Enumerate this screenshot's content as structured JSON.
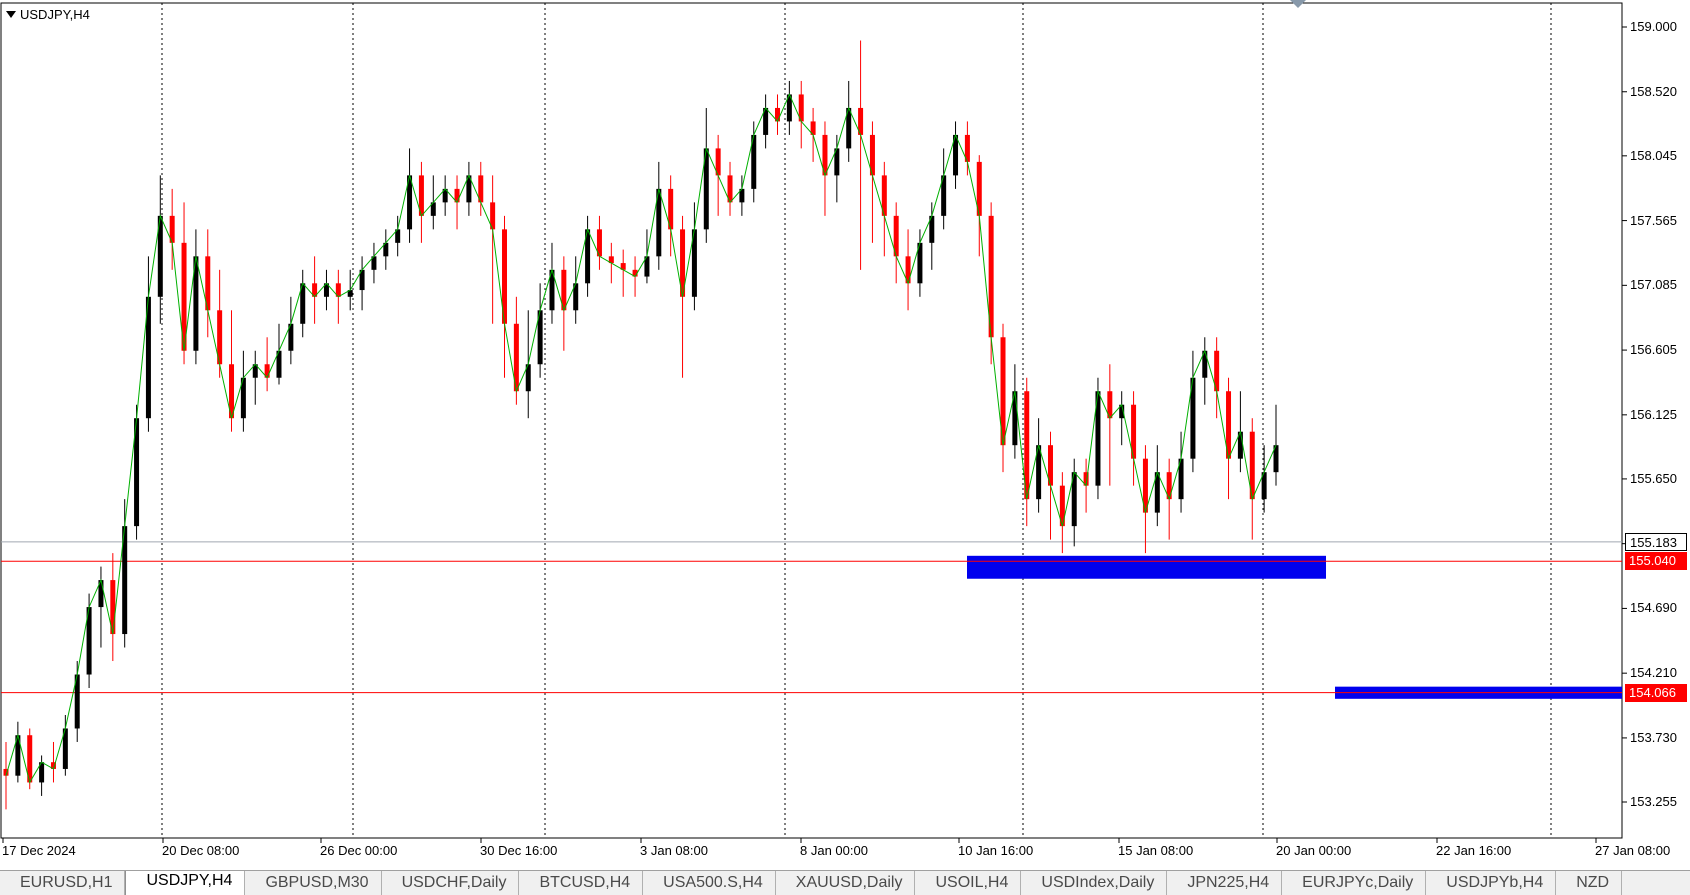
{
  "window": {
    "symbol_label": "USDJPY,H4"
  },
  "chart_data": {
    "type": "candlestick",
    "symbol": "USDJPY",
    "timeframe": "H4",
    "ylim": [
      152.95,
      159.2
    ],
    "y_ticks": [
      "159.000",
      "158.520",
      "158.045",
      "157.565",
      "157.085",
      "156.605",
      "156.125",
      "155.650",
      "155.170",
      "154.690",
      "154.210",
      "153.730",
      "153.255"
    ],
    "x_ticks": [
      "17 Dec 2024",
      "20 Dec 08:00",
      "26 Dec 00:00",
      "30 Dec 16:00",
      "3 Jan 08:00",
      "8 Jan 00:00",
      "10 Jan 16:00",
      "15 Jan 08:00",
      "20 Jan 00:00",
      "22 Jan 16:00",
      "27 Jan 08:00"
    ],
    "current_price": "155.183",
    "horizontal_lines": [
      {
        "price": 155.04,
        "label": "155.040",
        "color": "#ff0000"
      },
      {
        "price": 154.066,
        "label": "154.066",
        "color": "#ff0000"
      }
    ],
    "zones": [
      {
        "price_top": 155.08,
        "price_bottom": 154.91,
        "color": "#0000ee"
      },
      {
        "price_top": 154.11,
        "price_bottom": 154.02,
        "color": "#0000ee"
      }
    ],
    "overlay_line": {
      "name": "",
      "color": "#00b000"
    },
    "candles": [
      [
        153.5,
        153.45,
        153.7,
        153.2
      ],
      [
        153.45,
        153.75,
        153.85,
        153.4
      ],
      [
        153.75,
        153.4,
        153.8,
        153.35
      ],
      [
        153.4,
        153.55,
        153.6,
        153.3
      ],
      [
        153.55,
        153.5,
        153.7,
        153.4
      ],
      [
        153.5,
        153.8,
        153.9,
        153.45
      ],
      [
        153.8,
        154.2,
        154.3,
        153.7
      ],
      [
        154.2,
        154.7,
        154.8,
        154.1
      ],
      [
        154.7,
        154.9,
        155.0,
        154.4
      ],
      [
        154.9,
        154.5,
        155.1,
        154.3
      ],
      [
        154.5,
        155.3,
        155.5,
        154.4
      ],
      [
        155.3,
        156.1,
        156.2,
        155.2
      ],
      [
        156.1,
        157.0,
        157.3,
        156.0
      ],
      [
        157.0,
        157.6,
        157.9,
        156.8
      ],
      [
        157.6,
        157.4,
        157.8,
        157.2
      ],
      [
        157.4,
        156.6,
        157.7,
        156.5
      ],
      [
        156.6,
        157.3,
        157.5,
        156.5
      ],
      [
        157.3,
        156.9,
        157.5,
        156.7
      ],
      [
        156.9,
        156.5,
        157.2,
        156.4
      ],
      [
        156.5,
        156.1,
        156.9,
        156.0
      ],
      [
        156.1,
        156.4,
        156.6,
        156.0
      ],
      [
        156.4,
        156.5,
        156.6,
        156.2
      ],
      [
        156.5,
        156.4,
        156.7,
        156.3
      ],
      [
        156.4,
        156.6,
        156.8,
        156.35
      ],
      [
        156.6,
        156.8,
        157.0,
        156.5
      ],
      [
        156.8,
        157.1,
        157.2,
        156.7
      ],
      [
        157.1,
        157.0,
        157.3,
        156.8
      ],
      [
        157.0,
        157.1,
        157.2,
        156.9
      ],
      [
        157.1,
        157.0,
        157.2,
        156.8
      ],
      [
        157.0,
        157.05,
        157.2,
        156.9
      ],
      [
        157.05,
        157.2,
        157.3,
        156.9
      ],
      [
        157.2,
        157.3,
        157.4,
        157.1
      ],
      [
        157.3,
        157.4,
        157.5,
        157.2
      ],
      [
        157.4,
        157.5,
        157.6,
        157.3
      ],
      [
        157.5,
        157.9,
        158.1,
        157.4
      ],
      [
        157.9,
        157.6,
        158.0,
        157.4
      ],
      [
        157.6,
        157.7,
        157.9,
        157.5
      ],
      [
        157.7,
        157.8,
        157.9,
        157.6
      ],
      [
        157.8,
        157.7,
        157.9,
        157.5
      ],
      [
        157.7,
        157.9,
        158.0,
        157.6
      ],
      [
        157.9,
        157.7,
        158.0,
        157.6
      ],
      [
        157.7,
        157.5,
        157.9,
        156.8
      ],
      [
        157.5,
        156.8,
        157.6,
        156.4
      ],
      [
        156.8,
        156.3,
        157.0,
        156.2
      ],
      [
        156.3,
        156.5,
        156.9,
        156.1
      ],
      [
        156.5,
        156.9,
        157.1,
        156.4
      ],
      [
        156.9,
        157.2,
        157.4,
        156.8
      ],
      [
        157.2,
        156.9,
        157.3,
        156.6
      ],
      [
        156.9,
        157.1,
        157.3,
        156.8
      ],
      [
        157.1,
        157.5,
        157.6,
        157.0
      ],
      [
        157.5,
        157.3,
        157.6,
        157.2
      ],
      [
        157.3,
        157.25,
        157.4,
        157.1
      ],
      [
        157.25,
        157.2,
        157.35,
        157.0
      ],
      [
        157.2,
        157.15,
        157.3,
        157.0
      ],
      [
        157.15,
        157.3,
        157.5,
        157.1
      ],
      [
        157.3,
        157.8,
        158.0,
        157.2
      ],
      [
        157.8,
        157.5,
        157.9,
        157.3
      ],
      [
        157.5,
        157.0,
        157.6,
        156.4
      ],
      [
        157.0,
        157.5,
        157.7,
        156.9
      ],
      [
        157.5,
        158.1,
        158.4,
        157.4
      ],
      [
        158.1,
        157.9,
        158.2,
        157.6
      ],
      [
        157.9,
        157.7,
        158.0,
        157.6
      ],
      [
        157.7,
        157.8,
        157.9,
        157.6
      ],
      [
        157.8,
        158.2,
        158.3,
        157.7
      ],
      [
        158.2,
        158.4,
        158.5,
        158.1
      ],
      [
        158.4,
        158.3,
        158.5,
        158.2
      ],
      [
        158.3,
        158.5,
        158.6,
        158.2
      ],
      [
        158.5,
        158.3,
        158.6,
        158.1
      ],
      [
        158.3,
        158.2,
        158.4,
        158.0
      ],
      [
        158.2,
        157.9,
        158.3,
        157.6
      ],
      [
        157.9,
        158.1,
        158.2,
        157.7
      ],
      [
        158.1,
        158.4,
        158.6,
        158.0
      ],
      [
        158.4,
        158.2,
        158.9,
        157.2
      ],
      [
        158.2,
        157.9,
        158.3,
        157.4
      ],
      [
        157.9,
        157.6,
        158.0,
        157.3
      ],
      [
        157.6,
        157.3,
        157.7,
        157.1
      ],
      [
        157.3,
        157.1,
        157.5,
        156.9
      ],
      [
        157.1,
        157.4,
        157.5,
        157.0
      ],
      [
        157.4,
        157.6,
        157.7,
        157.2
      ],
      [
        157.6,
        157.9,
        158.1,
        157.5
      ],
      [
        157.9,
        158.2,
        158.3,
        157.8
      ],
      [
        158.2,
        158.0,
        158.3,
        157.9
      ],
      [
        158.0,
        157.6,
        158.05,
        157.3
      ],
      [
        157.6,
        156.7,
        157.7,
        156.5
      ],
      [
        156.7,
        155.9,
        156.8,
        155.7
      ],
      [
        155.9,
        156.3,
        156.5,
        155.8
      ],
      [
        156.3,
        155.5,
        156.4,
        155.3
      ],
      [
        155.5,
        155.9,
        156.1,
        155.4
      ],
      [
        155.9,
        155.6,
        156.0,
        155.2
      ],
      [
        155.6,
        155.3,
        155.7,
        155.1
      ],
      [
        155.3,
        155.7,
        155.8,
        155.15
      ],
      [
        155.7,
        155.6,
        155.8,
        155.4
      ],
      [
        155.6,
        156.3,
        156.4,
        155.5
      ],
      [
        156.3,
        156.1,
        156.5,
        155.6
      ],
      [
        156.1,
        156.2,
        156.3,
        155.9
      ],
      [
        156.2,
        155.8,
        156.3,
        155.6
      ],
      [
        155.8,
        155.4,
        155.9,
        155.1
      ],
      [
        155.4,
        155.7,
        155.9,
        155.3
      ],
      [
        155.7,
        155.5,
        155.8,
        155.2
      ],
      [
        155.5,
        155.8,
        156.0,
        155.4
      ],
      [
        155.8,
        156.4,
        156.6,
        155.7
      ],
      [
        156.4,
        156.6,
        156.7,
        156.2
      ],
      [
        156.6,
        156.3,
        156.7,
        156.1
      ],
      [
        156.3,
        155.8,
        156.4,
        155.5
      ],
      [
        155.8,
        156.0,
        156.3,
        155.7
      ],
      [
        156.0,
        155.5,
        156.1,
        155.2
      ],
      [
        155.5,
        155.7,
        155.9,
        155.4
      ],
      [
        155.7,
        155.9,
        156.2,
        155.6
      ]
    ]
  },
  "tabs": [
    {
      "label": "EURUSD,H1",
      "active": false
    },
    {
      "label": "USDJPY,H4",
      "active": true
    },
    {
      "label": "GBPUSD,M30",
      "active": false
    },
    {
      "label": "USDCHF,Daily",
      "active": false
    },
    {
      "label": "BTCUSD,H4",
      "active": false
    },
    {
      "label": "USA500.S,H4",
      "active": false
    },
    {
      "label": "XAUUSD,Daily",
      "active": false
    },
    {
      "label": "USOIL,H4",
      "active": false
    },
    {
      "label": "USDIndex,Daily",
      "active": false
    },
    {
      "label": "JPN225,H4",
      "active": false
    },
    {
      "label": "EURJPYc,Daily",
      "active": false
    },
    {
      "label": "USDJPYb,H4",
      "active": false
    },
    {
      "label": "NZD",
      "active": false
    }
  ]
}
